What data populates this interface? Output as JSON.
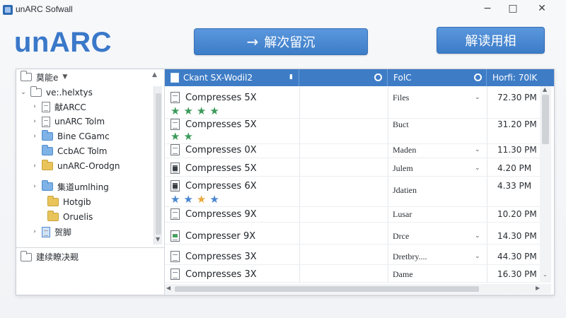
{
  "window": {
    "title": "unARC Sofwall",
    "min_glyph": "−",
    "max_glyph": "□",
    "close_glyph": "✕"
  },
  "brand": {
    "logo_text": "unARC"
  },
  "toolbar": {
    "extract_arrow": "→",
    "extract_label": "解次留沉",
    "decompress_label": "解读用相"
  },
  "tree": {
    "header_label": "莫能e",
    "header_caret": "▼",
    "items": [
      {
        "label": "ve:.helxtys",
        "expander": "⌄"
      },
      {
        "label": "献ARCC",
        "expander": "›"
      },
      {
        "label": "unARC Tolm",
        "expander": "›"
      },
      {
        "label": "Bine CGamc",
        "expander": "›"
      },
      {
        "label": "CcbAC Tolm",
        "expander": ""
      },
      {
        "label": "unARC-Orodgn",
        "expander": "›"
      },
      {
        "label": "集道umlhing",
        "expander": "›"
      },
      {
        "label": "Hotgib",
        "expander": ""
      },
      {
        "label": "Oruelis",
        "expander": ""
      },
      {
        "label": "贺脚",
        "expander": "›"
      }
    ],
    "footer_label": "建续瞭决觋"
  },
  "columns": {
    "name": "Ckant SX-Wodil2",
    "name_marker": "▮",
    "type": "FolC",
    "time": "Horfi: 70lK"
  },
  "rows": [
    {
      "name": "Compresses 5X",
      "type": "Files",
      "caret": "⌄",
      "time": "72.30 PM"
    },
    {
      "name": "Compresses 5X",
      "type": "Buct",
      "caret": "",
      "time": "31.20 PM"
    },
    {
      "name": "Compresses 0X",
      "type": "Maden",
      "caret": "⌄",
      "time": "11.30 PM"
    },
    {
      "name": "Compresses 5X",
      "type": "Julem",
      "caret": "⌄",
      "time": "4.20 PM"
    },
    {
      "name": "Compresses 6X",
      "type": "Jdatien",
      "caret": "",
      "time": "4.33 PM"
    },
    {
      "name": "Compresses 9X",
      "type": "Lusar",
      "caret": "",
      "time": "10.20 PM"
    },
    {
      "name": "Compresser 9X",
      "type": "Drce",
      "caret": "⌄",
      "time": "14.30 PM"
    },
    {
      "name": "Compresses 3X",
      "type": "Dretbry....",
      "caret": "⌄",
      "time": "44.30 PM"
    },
    {
      "name": "Compresses 3X",
      "type": "Dame",
      "caret": "",
      "time": "16.30 PM"
    }
  ],
  "ratings": [
    {
      "row": 0,
      "stars": 4,
      "color": "#3b9a5a"
    },
    {
      "row": 1,
      "stars": 2,
      "color": "#3b9a5a"
    },
    {
      "row": 4,
      "stars": 4,
      "colors": [
        "#4a86cf",
        "#4a86cf",
        "#e8a93a",
        "#4a86cf"
      ]
    }
  ],
  "colors": {
    "accent": "#3e7cc6",
    "brand": "#3a78c9"
  }
}
